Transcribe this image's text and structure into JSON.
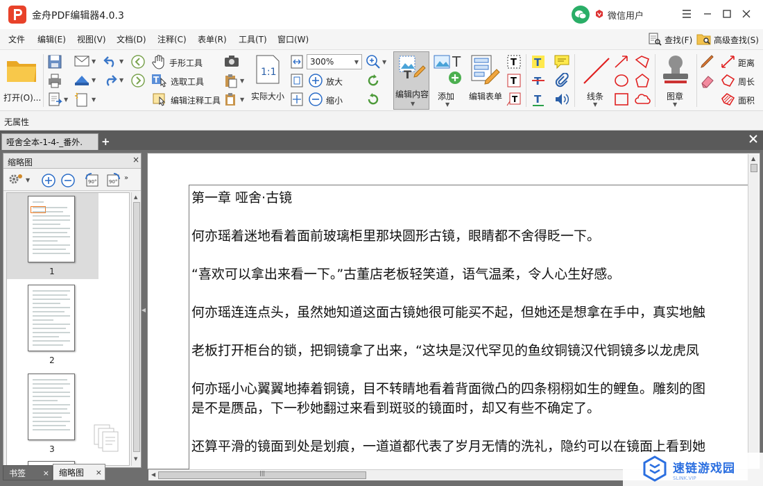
{
  "app": {
    "title": "金舟PDF编辑器4.0.3",
    "user_label": "微信用户",
    "brand_color": "#e8422a"
  },
  "menu": {
    "items": [
      {
        "label": "文件"
      },
      {
        "label": "编辑(E)"
      },
      {
        "label": "视图(V)"
      },
      {
        "label": "文档(D)"
      },
      {
        "label": "注释(C)"
      },
      {
        "label": "表单(R)"
      },
      {
        "label": "工具(T)"
      },
      {
        "label": "窗口(W)"
      }
    ],
    "find_label": "查找(F)",
    "adv_find_label": "高级查找(S)"
  },
  "ribbon": {
    "open_label": "打开(O)...",
    "hand_tool": "手形工具",
    "select_tool": "选取工具",
    "edit_annot_tool": "编辑注释工具",
    "actual_size": "实际大小",
    "zoom_value": "300%",
    "zoom_in": "放大",
    "zoom_out": "缩小",
    "edit_content": "编辑内容",
    "add": "添加",
    "edit_form": "编辑表单",
    "line": "线条",
    "stamp": "图章",
    "distance": "距离",
    "perimeter": "周长",
    "area": "面积",
    "rotate_90": "90°"
  },
  "propbar": {
    "label": "无属性"
  },
  "tabs": [
    {
      "label": "哑舍全本-1-4-_番外."
    }
  ],
  "thumbnail_panel": {
    "title": "缩略图",
    "pages": [
      "1",
      "2",
      "3"
    ],
    "selected_page": "1"
  },
  "bottom_tabs": [
    {
      "label": "书签"
    },
    {
      "label": "缩略图"
    }
  ],
  "document": {
    "lines": [
      "第一章 哑舍·古镜",
      "何亦瑶着迷地看着面前玻璃柜里那块圆形古镜，眼睛都不舍得眨一下。",
      "“喜欢可以拿出来看一下。”古董店老板轻笑道，语气温柔，令人心生好感。",
      "何亦瑶连连点头，虽然她知道这面古镜她很可能买不起，但她还是想拿在手中，真实地触",
      "老板打开柜台的锁，把铜镜拿了出来，“这块是汉代罕见的鱼纹铜镜汉代铜镜多以龙虎凤",
      "何亦瑶小心翼翼地捧着铜镜，目不转睛地看着背面微凸的四条栩栩如生的鲤鱼。雕刻的图",
      "是不是赝品，下一秒她翻过来看到斑驳的镜面时，却又有些不确定了。",
      "还算平滑的镜面到处是划痕，一道道都代表了岁月无情的洗礼，隐约可以在镜面上看到她"
    ]
  },
  "watermark": {
    "text": "速链游戏园",
    "sub": "SLINK.VIP"
  }
}
